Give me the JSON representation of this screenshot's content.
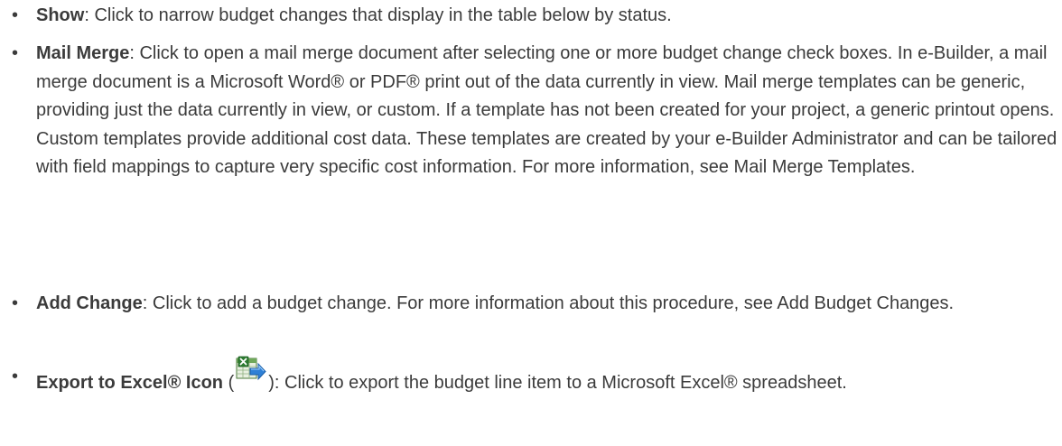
{
  "items": [
    {
      "term": "Show",
      "text": ": Click to narrow budget changes that display in the table below by status."
    },
    {
      "term": "Mail Merge",
      "text": ": Click to open a mail merge document after selecting one or more budget change check boxes. In e-Builder, a mail merge document is a Microsoft Word® or PDF® print out of the data currently in view. Mail merge templates can be generic, providing just the data currently in view, or custom. If a template has not been created for your project, a generic printout opens. Custom templates provide additional cost data. These templates are created by your e-Builder Administrator and can be tailored with field mappings to capture very specific cost information. For more information, see Mail Merge Templates."
    },
    {
      "term": "Add Change",
      "text": ": Click to add a budget change. For more information about this procedure, see Add Budget Changes."
    },
    {
      "term": "Export to Excel® Icon",
      "pre_icon": " (",
      "icon": "excel-export-icon",
      "post_icon": "):  Click to export the budget line item to a Microsoft Excel® spreadsheet."
    }
  ],
  "bullet": "•"
}
